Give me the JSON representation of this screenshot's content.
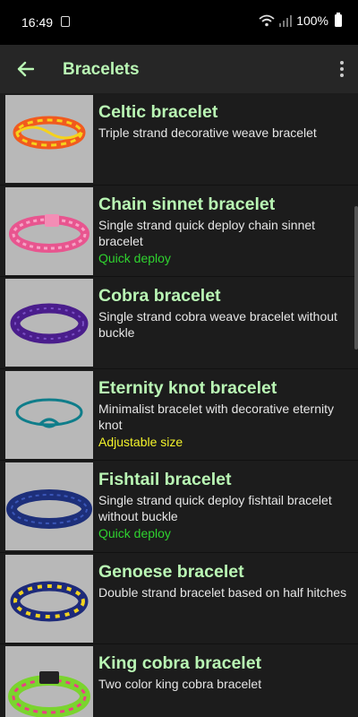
{
  "status": {
    "time": "16:49",
    "battery": "100%"
  },
  "app_bar": {
    "title": "Bracelets",
    "back_icon": "arrow-left-icon",
    "menu_icon": "more-vert-icon"
  },
  "colors": {
    "title_green": "#b9f6b4",
    "tag_green": "#2fd22f",
    "tag_yellow": "#f3f32a"
  },
  "items": [
    {
      "title": "Celtic bracelet",
      "description": "Triple strand decorative weave bracelet",
      "tag": ""
    },
    {
      "title": "Chain sinnet bracelet",
      "description": "Single strand quick deploy chain sinnet bracelet",
      "tag": "Quick deploy"
    },
    {
      "title": "Cobra bracelet",
      "description": "Single strand cobra weave bracelet without buckle",
      "tag": ""
    },
    {
      "title": "Eternity knot bracelet",
      "description": "Minimalist bracelet with decorative eternity knot",
      "tag": "Adjustable size"
    },
    {
      "title": "Fishtail bracelet",
      "description": "Single strand quick deploy fishtail bracelet without buckle",
      "tag": "Quick deploy"
    },
    {
      "title": "Genoese bracelet",
      "description": "Double strand bracelet based on half hitches",
      "tag": ""
    },
    {
      "title": "King cobra bracelet",
      "description": "Two color king cobra bracelet",
      "tag": ""
    }
  ]
}
